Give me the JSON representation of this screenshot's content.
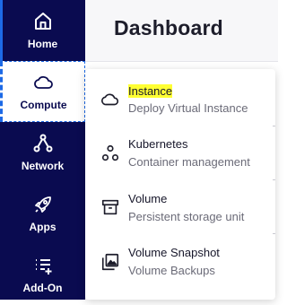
{
  "sidebar": {
    "items": [
      {
        "label": "Home",
        "icon": "home-icon"
      },
      {
        "label": "Compute",
        "icon": "cloud-icon"
      },
      {
        "label": "Network",
        "icon": "network-icon"
      },
      {
        "label": "Apps",
        "icon": "rocket-icon"
      },
      {
        "label": "Add-On",
        "icon": "add-list-icon"
      }
    ]
  },
  "header": {
    "title": "Dashboard"
  },
  "compute_menu": {
    "items": [
      {
        "title": "Instance",
        "subtitle": "Deploy Virtual Instance",
        "icon": "cloud-icon"
      },
      {
        "title": "Kubernetes",
        "subtitle": "Container management",
        "icon": "cluster-icon"
      },
      {
        "title": "Volume",
        "subtitle": "Persistent storage unit",
        "icon": "archive-icon"
      },
      {
        "title": "Volume Snapshot",
        "subtitle": "Volume Backups",
        "icon": "snapshot-icon"
      }
    ]
  },
  "colors": {
    "sidebar_bg": "#0a0b50",
    "accent": "#1d6ae6",
    "highlight": "#ffff33"
  }
}
